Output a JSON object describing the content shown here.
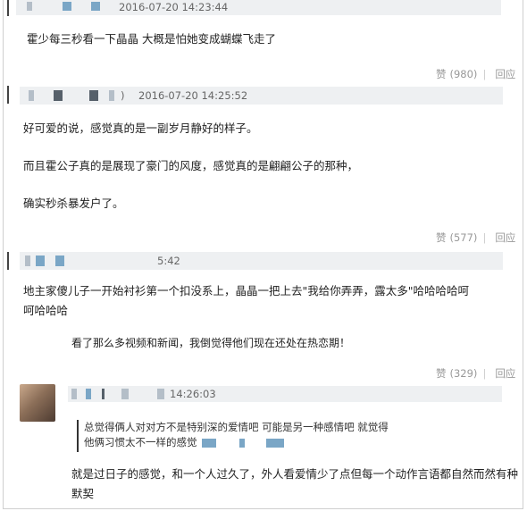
{
  "comments": [
    {
      "timestamp": "2016-07-20 14:23:44",
      "lines": [
        "霍少每三秒看一下晶晶 大概是怕她变成蝴蝶飞走了"
      ],
      "like_label": "赞",
      "like_count": "(980)",
      "reply_label": "回应"
    },
    {
      "prefix": ")",
      "timestamp": "2016-07-20 14:25:52",
      "lines": [
        "好可爱的说，感觉真的是一副岁月静好的样子。",
        "而且霍公子真的是展现了豪门的风度，感觉真的是翩翩公子的那种，",
        "确实秒杀暴发户了。"
      ],
      "like_label": "赞",
      "like_count": "(577)",
      "reply_label": "回应"
    },
    {
      "timestamp": "5:42",
      "lines": [
        "地主家傻儿子一开始衬衫第一个扣没系上，晶晶一把上去\"我给你弄弄，露太多\"哈哈哈哈呵",
        "呵哈哈哈"
      ]
    },
    {
      "reply_text": "看了那么多视频和新闻，我倒觉得他们现在还处在热恋期！",
      "like_label": "赞",
      "like_count": "(329)",
      "reply_label": "回应"
    },
    {
      "timestamp": "14:26:03",
      "quote_lines": [
        "总觉得俩人对对方不是特别深的爱情吧 可能是另一种感情吧 就觉得",
        "他俩习惯太不一样的感觉"
      ],
      "lines": [
        "就是过日子的感觉，和一个人过久了，外人看爱情少了点但每一个动作言语都自然而然有种",
        "默契"
      ]
    }
  ]
}
